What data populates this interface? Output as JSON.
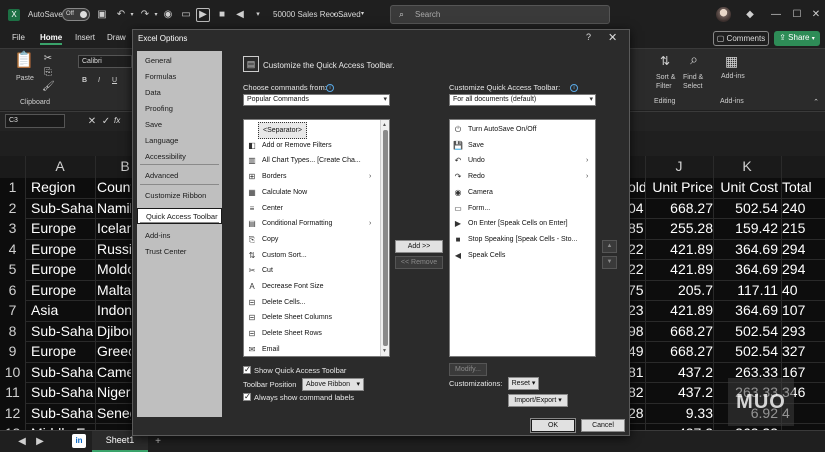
{
  "titlebar": {
    "autosave_label": "AutoSave",
    "autosave_state": "Off",
    "doc_title": "50000 Sales Reco...",
    "saved_status": "• Saved",
    "search_placeholder": "Search"
  },
  "menu": {
    "tabs": [
      "File",
      "Home",
      "Insert",
      "Draw"
    ],
    "active": "Home",
    "comments_label": "Comments",
    "share_label": "Share"
  },
  "ribbon": {
    "paste_label": "Paste",
    "clipboard_label": "Clipboard",
    "font_name": "Calibri",
    "bold": "B",
    "italic": "I",
    "underline": "U",
    "sort_filter": "Sort &\nFilter",
    "find_select": "Find &\nSelect",
    "editing_label": "Editing",
    "addins_label": "Add-ins",
    "addins_group": "Add-ins"
  },
  "formula": {
    "name_box": "C3",
    "fx": "fx"
  },
  "sheet": {
    "columns_left": [
      {
        "letter": "A"
      },
      {
        "letter": "B"
      }
    ],
    "columns_right": [
      {
        "letter": "J"
      },
      {
        "letter": "K"
      }
    ],
    "rows": [
      {
        "n": "1",
        "a": "Region",
        "b": "Count",
        "i": "old",
        "j": "Unit Price",
        "k": "Unit Cost",
        "l": "Total"
      },
      {
        "n": "2",
        "a": "Sub-Sahar",
        "b": "Namib",
        "i": "04",
        "j": "668.27",
        "k": "502.54",
        "l": "240"
      },
      {
        "n": "3",
        "a": "Europe",
        "b": "Icelan",
        "i": "85",
        "j": "255.28",
        "k": "159.42",
        "l": "215"
      },
      {
        "n": "4",
        "a": "Europe",
        "b": "Russia",
        "i": "22",
        "j": "421.89",
        "k": "364.69",
        "l": "294"
      },
      {
        "n": "5",
        "a": "Europe",
        "b": "Moldo",
        "i": "22",
        "j": "421.89",
        "k": "364.69",
        "l": "294"
      },
      {
        "n": "6",
        "a": "Europe",
        "b": "Malta",
        "i": "75",
        "j": "205.7",
        "k": "117.11",
        "l": "40"
      },
      {
        "n": "7",
        "a": "Asia",
        "b": "Indon",
        "i": "23",
        "j": "421.89",
        "k": "364.69",
        "l": "107"
      },
      {
        "n": "8",
        "a": "Sub-Sahar",
        "b": "Djibou",
        "i": "98",
        "j": "668.27",
        "k": "502.54",
        "l": "293"
      },
      {
        "n": "9",
        "a": "Europe",
        "b": "Greec",
        "i": "49",
        "j": "668.27",
        "k": "502.54",
        "l": "327"
      },
      {
        "n": "10",
        "a": "Sub-Sahar",
        "b": "Came",
        "i": "81",
        "j": "437.2",
        "k": "263.33",
        "l": "167"
      },
      {
        "n": "11",
        "a": "Sub-Sahar",
        "b": "Niger",
        "i": "82",
        "j": "437.2",
        "k": "263.33",
        "l": "346"
      },
      {
        "n": "12",
        "a": "Sub-Sahar",
        "b": "Seneg",
        "i": "28",
        "j": "9.33",
        "k": "6.92",
        "l": "4"
      },
      {
        "n": "13",
        "a": "Middle E",
        "b": "",
        "i": "",
        "j": "437.2",
        "k": "263.33",
        "l": ""
      }
    ],
    "sheet_tab": "Sheet1"
  },
  "dialog": {
    "title": "Excel Options",
    "help": "?",
    "close": "✕",
    "nav": [
      "General",
      "Formulas",
      "Data",
      "Proofing",
      "Save",
      "Language",
      "Accessibility",
      "Advanced",
      "Customize Ribbon",
      "Quick Access Toolbar",
      "Add-ins",
      "Trust Center"
    ],
    "nav_selected": "Quick Access Toolbar",
    "heading": "Customize the Quick Access Toolbar.",
    "choose_label": "Choose commands from:",
    "choose_value": "Popular Commands",
    "customize_label": "Customize Quick Access Toolbar:",
    "customize_value": "For all documents (default)",
    "left_list": [
      {
        "icon": "",
        "label": "<Separator>",
        "submenu": false
      },
      {
        "icon": "◧",
        "label": "Add or Remove Filters",
        "submenu": false
      },
      {
        "icon": "▥",
        "label": "All Chart Types... [Create Cha...",
        "submenu": false
      },
      {
        "icon": "⊞",
        "label": "Borders",
        "submenu": true
      },
      {
        "icon": "▦",
        "label": "Calculate Now",
        "submenu": false
      },
      {
        "icon": "≡",
        "label": "Center",
        "submenu": false
      },
      {
        "icon": "▤",
        "label": "Conditional Formatting",
        "submenu": true
      },
      {
        "icon": "⎘",
        "label": "Copy",
        "submenu": false
      },
      {
        "icon": "⇅",
        "label": "Custom Sort...",
        "submenu": false
      },
      {
        "icon": "✂",
        "label": "Cut",
        "submenu": false
      },
      {
        "icon": "A",
        "label": "Decrease Font Size",
        "submenu": false
      },
      {
        "icon": "⊟",
        "label": "Delete Cells...",
        "submenu": false
      },
      {
        "icon": "⊟",
        "label": "Delete Sheet Columns",
        "submenu": false
      },
      {
        "icon": "⊟",
        "label": "Delete Sheet Rows",
        "submenu": false
      },
      {
        "icon": "✉",
        "label": "Email",
        "submenu": false
      }
    ],
    "right_list": [
      {
        "icon": "⏻",
        "label": "Turn AutoSave On/Off",
        "submenu": false
      },
      {
        "icon": "💾",
        "label": "Save",
        "submenu": false
      },
      {
        "icon": "↶",
        "label": "Undo",
        "submenu": true
      },
      {
        "icon": "↷",
        "label": "Redo",
        "submenu": true
      },
      {
        "icon": "◉",
        "label": "Camera",
        "submenu": false
      },
      {
        "icon": "▭",
        "label": "Form...",
        "submenu": false
      },
      {
        "icon": "▶",
        "label": "On Enter [Speak Cells on Enter]",
        "submenu": false
      },
      {
        "icon": "■",
        "label": "Stop Speaking [Speak Cells - Sto...",
        "submenu": false
      },
      {
        "icon": "◀",
        "label": "Speak Cells",
        "submenu": false
      }
    ],
    "add_button": "Add >>",
    "remove_button": "<< Remove",
    "move_up": "▲",
    "move_down": "▼",
    "modify_button": "Modify...",
    "customizations_label": "Customizations:",
    "reset_button": "Reset ▾",
    "import_export_button": "Import/Export ▾",
    "show_qat_label": "Show Quick Access Toolbar",
    "toolbar_position_label": "Toolbar Position",
    "toolbar_position_value": "Above Ribbon",
    "always_show_label": "Always show command labels",
    "ok": "OK",
    "cancel": "Cancel"
  },
  "watermark": "MUO"
}
